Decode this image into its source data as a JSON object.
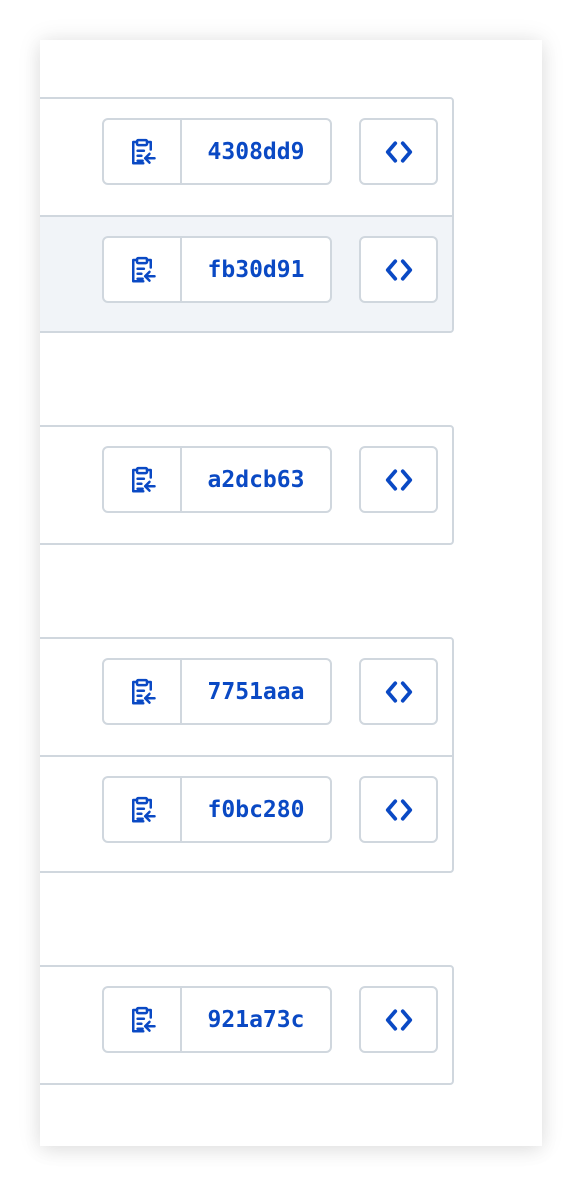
{
  "colors": {
    "accent": "#0a49c4",
    "border": "#d0d7de",
    "row_highlight": "#f1f4f8"
  },
  "icons": {
    "copy": "clipboard-copy-icon",
    "browse": "code-icon"
  },
  "groups": [
    {
      "commits": [
        {
          "sha": "4308dd9",
          "highlighted": false
        },
        {
          "sha": "fb30d91",
          "highlighted": true
        }
      ]
    },
    {
      "commits": [
        {
          "sha": "a2dcb63",
          "highlighted": false
        }
      ]
    },
    {
      "commits": [
        {
          "sha": "7751aaa",
          "highlighted": false
        },
        {
          "sha": "f0bc280",
          "highlighted": false
        }
      ]
    },
    {
      "commits": [
        {
          "sha": "921a73c",
          "highlighted": false
        }
      ]
    }
  ]
}
